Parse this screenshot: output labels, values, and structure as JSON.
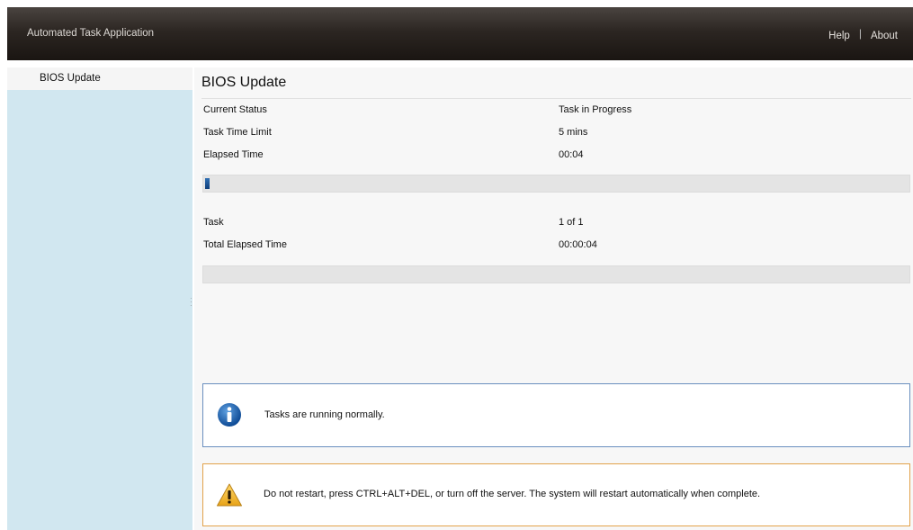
{
  "header": {
    "app_title": "Automated Task Application",
    "links": {
      "help": "Help",
      "separator": "|",
      "about": "About"
    }
  },
  "sidebar": {
    "items": [
      {
        "label": "BIOS Update"
      }
    ]
  },
  "main": {
    "title": "BIOS Update",
    "current_status": {
      "label": "Current Status",
      "value": "Task in Progress"
    },
    "task_time_limit": {
      "label": "Task Time Limit",
      "value": "5 mins"
    },
    "elapsed_time": {
      "label": "Elapsed Time",
      "value": "00:04"
    },
    "task_progress_fraction": 0.005,
    "task": {
      "label": "Task",
      "value": "1 of 1"
    },
    "total_elapsed_time": {
      "label": "Total Elapsed Time",
      "value": "00:00:04"
    },
    "overall_progress_fraction": 0
  },
  "alerts": {
    "info": {
      "icon": "info-icon",
      "message": "Tasks are running normally."
    },
    "warning": {
      "icon": "warning-icon",
      "message": "Do not restart, press CTRL+ALT+DEL, or turn off the server.  The system will restart automatically when complete."
    }
  },
  "colors": {
    "header_dark": "#2c2622",
    "sidebar_bg": "#d1e7f0",
    "progress_blue": "#1f5a9e",
    "info_border": "#6a8fbf",
    "warning_border": "#e2a24a"
  }
}
